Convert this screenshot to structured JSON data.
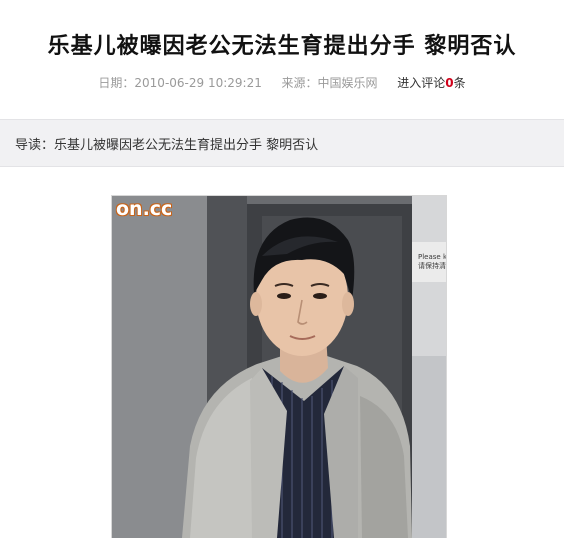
{
  "article": {
    "title": "乐基儿被曝因老公无法生育提出分手 黎明否认",
    "date_label": "日期：",
    "date": "2010-06-29 10:29:21",
    "source_label": "来源：",
    "source": "中国娱乐网",
    "comments_prefix": "进入评论",
    "comments_count": "0",
    "comments_suffix": "条",
    "summary_label": "导读：",
    "summary": "乐基儿被曝因老公无法生育提出分手 黎明否认"
  },
  "photo": {
    "watermark": "on.cc",
    "sign_line1": "Please ka",
    "sign_line2": "请保持清"
  },
  "colors": {
    "summary_bg": "#f1f1f3",
    "comment_count": "#d0021b",
    "watermark_orange": "#c8641a"
  }
}
